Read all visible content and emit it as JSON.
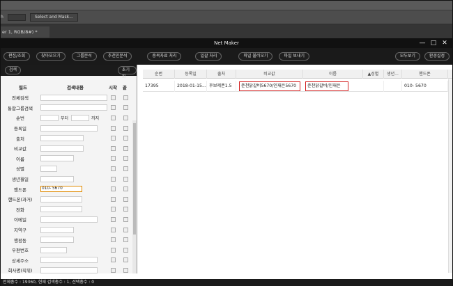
{
  "host": {
    "select_mask": "Select and Mask...",
    "doc_tab": "er 1, RGB/8#) *",
    "strip_label": "h"
  },
  "window": {
    "title": "Net Maker"
  },
  "toolbar": {
    "buttons": [
      "편집/조회",
      "찾아모으기",
      "그룹분석",
      "추천인분석",
      "중복자료 처리",
      "일괄 처리",
      "파일 불러오기",
      "파일 보내기"
    ],
    "right_buttons": [
      "모두보기",
      "환경설정"
    ]
  },
  "left_panel": {
    "search_button": "검색",
    "reset_button": "초기화",
    "header": {
      "field": "필드",
      "content": "검색내용",
      "start": "시작",
      "end": "끝"
    },
    "range_from": "부터",
    "range_to": "까지",
    "phone_value": "010-        5670",
    "fields": [
      "전체검색",
      "통합그룹검색",
      "순번",
      "등록일",
      "출처",
      "비교값",
      "이름",
      "성별",
      "생년월일",
      "핸드폰",
      "핸드폰(과거)",
      "전화",
      "이메일",
      "지역구",
      "행정동",
      "우편번호",
      "상세주소",
      "회사명(직위)"
    ]
  },
  "grid": {
    "columns": [
      "순번",
      "등록일",
      "출처",
      "비교값",
      "이름",
      "▲성별",
      "생년...",
      "핸드폰"
    ],
    "rows": [
      {
        "seq": "17395",
        "date": "2018-01-15...",
        "source": "후보제폰1.5",
        "compare": "춘천닭갈비5670/인재은5670",
        "name": "춘천닭갈비/인재은",
        "gender": "",
        "birth": "",
        "phone": "010-        5670"
      }
    ]
  },
  "status": {
    "text": "전체총수 : 19360, 현재 검색총수 : 1, 선택총수 : 0"
  }
}
